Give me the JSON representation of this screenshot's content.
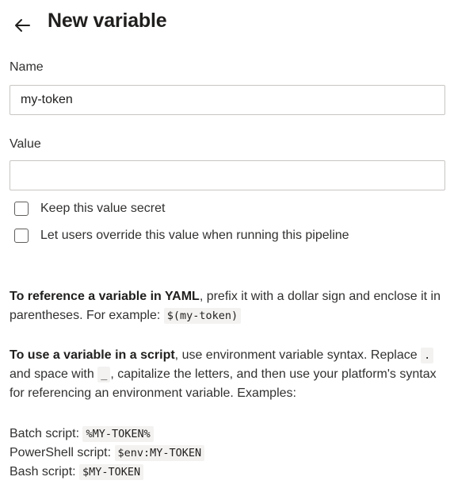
{
  "header": {
    "back_icon": "arrow-left-icon",
    "title": "New variable"
  },
  "form": {
    "name_label": "Name",
    "name_value": "my-token",
    "value_label": "Value",
    "value_value": "",
    "checkbox_secret_label": "Keep this value secret",
    "checkbox_secret_checked": false,
    "checkbox_override_label": "Let users override this value when running this pipeline",
    "checkbox_override_checked": false
  },
  "help": {
    "yaml_bold": "To reference a variable in YAML",
    "yaml_text": ", prefix it with a dollar sign and enclose it in parentheses. For example: ",
    "yaml_code": "$(my-token)",
    "script_bold": "To use a variable in a script",
    "script_text_1": ", use environment variable syntax. Replace ",
    "script_code_dot": ".",
    "script_text_2": " and space with ",
    "script_code_underscore": "_",
    "script_text_3": ", capitalize the letters, and then use your platform's syntax for referencing an environment variable. Examples:",
    "examples": [
      {
        "label": "Batch script: ",
        "code": "%MY-TOKEN%"
      },
      {
        "label": "PowerShell script: ",
        "code": "$env:MY-TOKEN"
      },
      {
        "label": "Bash script: ",
        "code": "$MY-TOKEN"
      }
    ]
  }
}
